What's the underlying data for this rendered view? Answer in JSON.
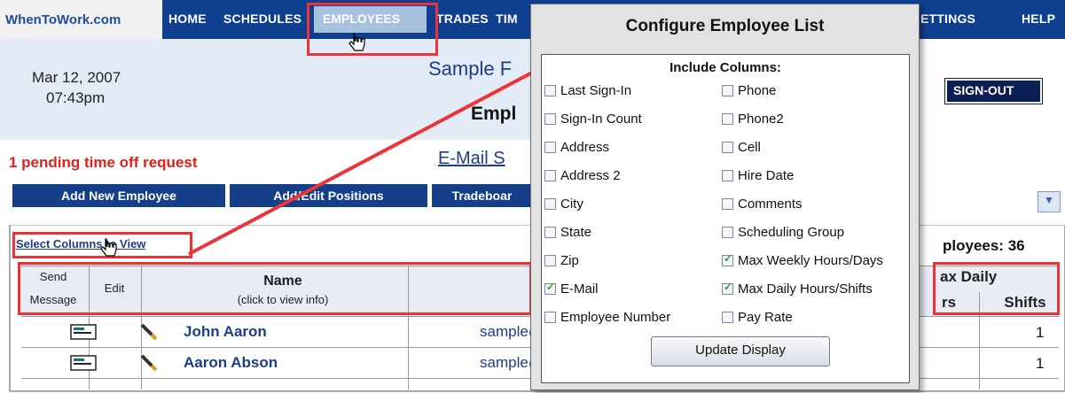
{
  "nav": {
    "brand": "WhenToWork.com",
    "items": [
      "HOME",
      "SCHEDULES",
      "EMPLOYEES",
      "TRADES",
      "TIM",
      "ETTINGS",
      "HELP"
    ]
  },
  "header": {
    "date": "Mar 12, 2007",
    "time": "07:43pm",
    "company": "Sample F",
    "section": "Empl",
    "signout": "SIGN-OUT"
  },
  "pending": "1 pending time off request",
  "email_link": "E-Mail S",
  "actions": [
    "Add New Employee",
    "Add/Edit Positions",
    "Tradeboar"
  ],
  "table": {
    "select_columns": "Select Columns to View",
    "total": "ployees: 36",
    "headers": {
      "send": "Send",
      "message": "Message",
      "edit": "Edit",
      "name": "Name",
      "name_sub": "(click to view info)",
      "max_daily": "ax Daily",
      "hours_partial": "rs",
      "shifts": "Shifts"
    },
    "rows": [
      {
        "name": "John Aaron",
        "email": "sample@",
        "shifts": "1"
      },
      {
        "name": "Aaron Abson",
        "email": "sample@",
        "shifts": "1"
      }
    ]
  },
  "dialog": {
    "title": "Configure Employee List",
    "heading": "Include Columns:",
    "left_options": [
      {
        "label": "Last Sign-In",
        "checked": false
      },
      {
        "label": "Sign-In Count",
        "checked": false
      },
      {
        "label": "Address",
        "checked": false
      },
      {
        "label": "Address 2",
        "checked": false
      },
      {
        "label": "City",
        "checked": false
      },
      {
        "label": "State",
        "checked": false
      },
      {
        "label": "Zip",
        "checked": false
      },
      {
        "label": "E-Mail",
        "checked": true
      },
      {
        "label": "Employee Number",
        "checked": false
      }
    ],
    "right_options": [
      {
        "label": "Phone",
        "checked": false
      },
      {
        "label": "Phone2",
        "checked": false
      },
      {
        "label": "Cell",
        "checked": false
      },
      {
        "label": "Hire Date",
        "checked": false
      },
      {
        "label": "Comments",
        "checked": false
      },
      {
        "label": "Scheduling Group",
        "checked": false
      },
      {
        "label": "Max Weekly Hours/Days",
        "checked": true
      },
      {
        "label": "Max Daily Hours/Shifts",
        "checked": true
      },
      {
        "label": "Pay Rate",
        "checked": false
      }
    ],
    "update_button": "Update Display"
  },
  "colors": {
    "nav_bg": "#0f3f8f",
    "annotation_red": "#ec3337",
    "link_blue": "#1c3d8c",
    "alert_red": "#e0201a"
  }
}
